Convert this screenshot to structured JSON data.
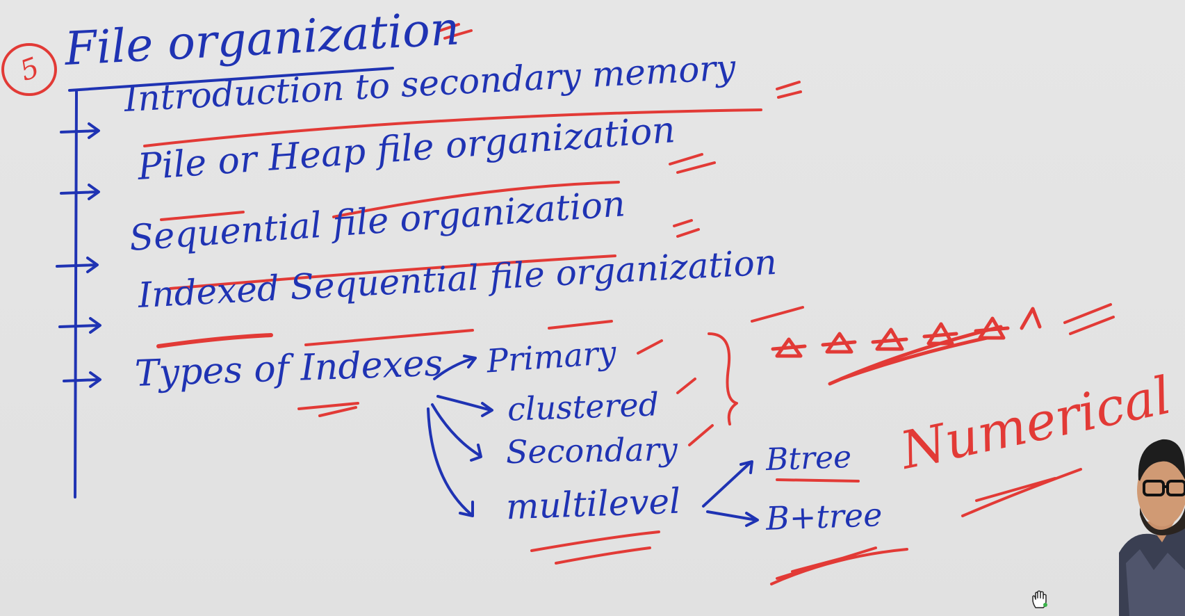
{
  "board": {
    "section_number": "5",
    "title": "File organization",
    "topics": [
      "Introduction to secondary memory",
      "Pile or Heap file organization",
      "Sequential file organization",
      "Indexed Sequential file organization",
      "Types of Indexes"
    ],
    "index_types": [
      "Primary",
      "clustered",
      "Secondary",
      "multilevel"
    ],
    "multilevel_children": [
      "Btree",
      "B+tree"
    ],
    "annotation": "Numerical",
    "colors": {
      "blue_ink": "#1f33b3",
      "red_ink": "#e23a36",
      "board": "#e3e3e3"
    }
  }
}
